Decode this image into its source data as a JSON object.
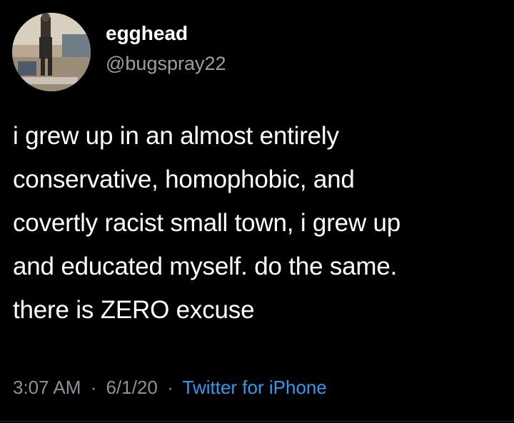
{
  "user": {
    "display_name": "egghead",
    "handle": "@bugspray22"
  },
  "tweet": {
    "lines": [
      "i grew up in an almost entirely",
      "conservative, homophobic, and",
      "covertly racist small town, i grew up",
      "and educated myself. do the same.",
      "there is ZERO excuse"
    ]
  },
  "meta": {
    "time": "3:07 AM",
    "separator": "·",
    "date": "6/1/20",
    "source": "Twitter for iPhone"
  },
  "colors": {
    "background": "#000000",
    "text": "#ffffff",
    "secondary_text": "#8b9196",
    "link": "#2f9bf0"
  }
}
